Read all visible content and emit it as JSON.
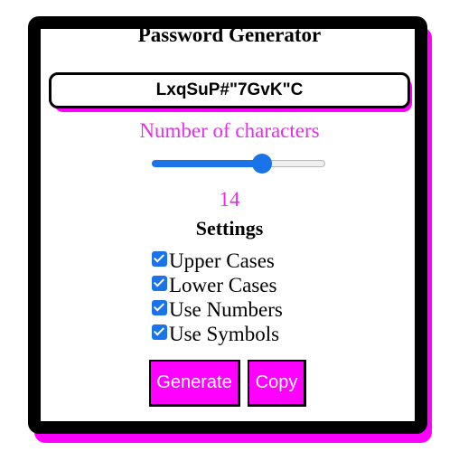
{
  "app": {
    "title": "Password Generator"
  },
  "password": {
    "value": "LxqSuP#\"7GvK\"C"
  },
  "length": {
    "label": "Number of characters",
    "value": "14",
    "slider_fraction": 0.65
  },
  "settings": {
    "title": "Settings",
    "options": [
      {
        "label": "Upper Cases",
        "checked": true
      },
      {
        "label": "Lower Cases",
        "checked": true
      },
      {
        "label": "Use Numbers",
        "checked": true
      },
      {
        "label": "Use Symbols",
        "checked": true
      }
    ]
  },
  "buttons": {
    "generate_label": "Generate",
    "copy_label": "Copy"
  },
  "colors": {
    "accent": "#ff00ff",
    "label_text": "#e62ee6",
    "slider": "#1a73e8",
    "border": "#000000"
  }
}
